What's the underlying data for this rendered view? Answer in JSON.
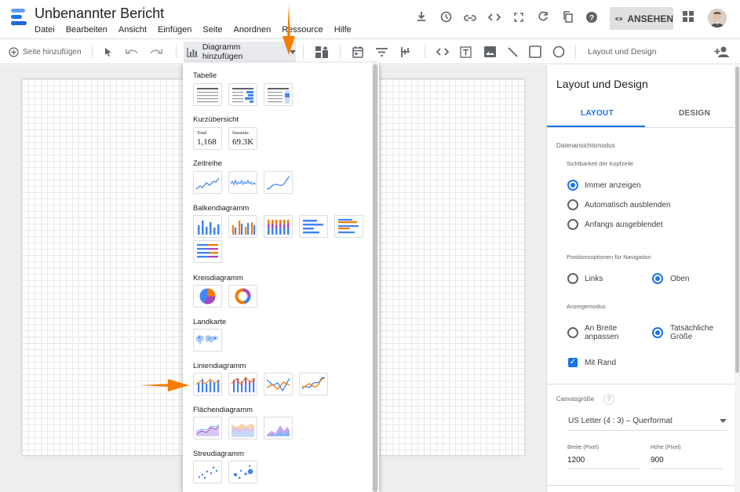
{
  "app": {
    "title": "Unbenannter Bericht",
    "menu": [
      "Datei",
      "Bearbeiten",
      "Ansicht",
      "Einfügen",
      "Seite",
      "Anordnen",
      "Ressource",
      "Hilfe"
    ],
    "view_button": "ANSEHEN"
  },
  "toolbar": {
    "add_page": "Seite hinzufügen",
    "add_chart": "Diagramm hinzufügen",
    "layout_design": "Layout und Design"
  },
  "dropdown": {
    "sections": {
      "table": "Tabelle",
      "scorecard": "Kurzübersicht",
      "timeseries": "Zeitreihe",
      "bar": "Balkendiagramm",
      "pie": "Kreisdiagramm",
      "geo": "Landkarte",
      "line": "Liniendiagramm",
      "area": "Flächendiagramm",
      "scatter": "Streudiagramm"
    },
    "scorecard1": {
      "label": "Total",
      "value": "1,168"
    },
    "scorecard2": {
      "label": "Sessions",
      "value": "69.3K"
    }
  },
  "panel": {
    "title": "Layout und Design",
    "tab_layout": "LAYOUT",
    "tab_design": "DESIGN",
    "data_view_mode": "Datenansichtsmodus",
    "header_visibility": "Sichtbarkeit der Kopfzeile",
    "opt_always": "Immer anzeigen",
    "opt_auto_hide": "Automatisch ausblenden",
    "opt_initially_hidden": "Anfangs ausgeblendet",
    "nav_position": "Positionsoptionen für Navigation",
    "opt_left": "Links",
    "opt_top": "Oben",
    "display_mode": "Anzeigemodus",
    "opt_fit_width_1": "An Breite",
    "opt_fit_width_2": "anpassen",
    "opt_actual_1": "Tatsächliche",
    "opt_actual_2": "Größe",
    "with_border": "Mit Rand",
    "canvas_size": "Canvasgröße",
    "help": "?",
    "canvas_option": "US Letter (4 : 3) – Querformat",
    "width_label": "Breite (Pixel)",
    "width_value": "1200",
    "height_label": "Höhe (Pixel)",
    "height_value": "900"
  },
  "colors": {
    "accent": "#1a73e8",
    "orange": "#f57c00",
    "chart_blue": "#4285f4"
  }
}
